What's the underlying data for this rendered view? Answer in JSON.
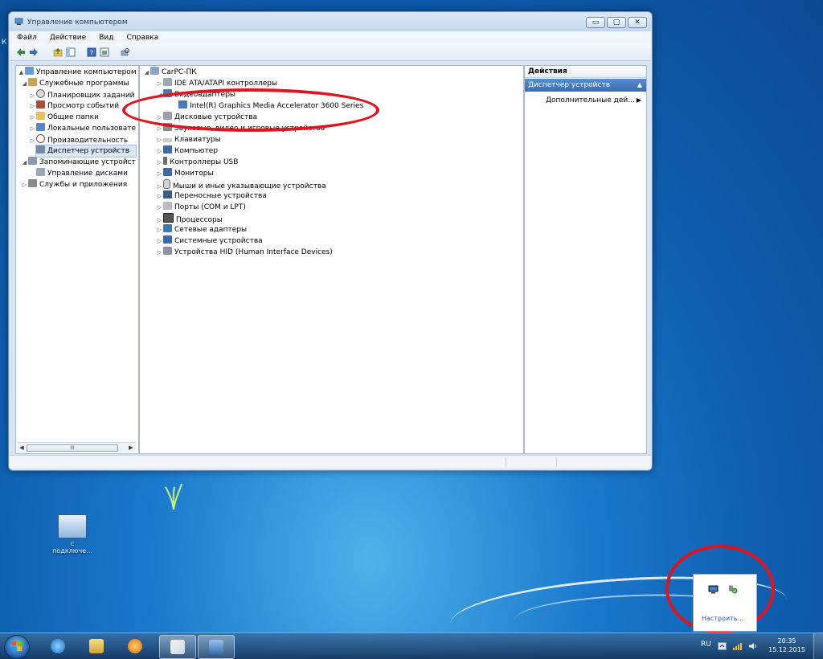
{
  "window": {
    "title": "Управление компьютером",
    "buttons": {
      "minimize": "▭",
      "maximize": "▢",
      "close": "✕"
    }
  },
  "menu": [
    "Файл",
    "Действие",
    "Вид",
    "Справка"
  ],
  "left_tree": [
    {
      "label": "Управление компьютером (л",
      "exp": "▲"
    },
    {
      "label": "Служебные программы",
      "exp": "◢"
    },
    {
      "label": "Планировщик заданий",
      "exp": "▷"
    },
    {
      "label": "Просмотр событий",
      "exp": "▷"
    },
    {
      "label": "Общие папки",
      "exp": "▷"
    },
    {
      "label": "Локальные пользовате",
      "exp": "▷"
    },
    {
      "label": "Производительность",
      "exp": "▷"
    },
    {
      "label": "Диспетчер устройств",
      "exp": ""
    },
    {
      "label": "Запоминающие устройст",
      "exp": "◢"
    },
    {
      "label": "Управление дисками",
      "exp": ""
    },
    {
      "label": "Службы и приложения",
      "exp": "▷"
    }
  ],
  "left_scroll": {
    "thumb": "III"
  },
  "device_tree": [
    {
      "label": "CarPC-ПК",
      "exp": "◢"
    },
    {
      "label": "IDE ATA/ATAPI контроллеры",
      "exp": "▷"
    },
    {
      "label": "Видеоадаптеры",
      "exp": "◢"
    },
    {
      "label": "Intel(R) Graphics Media Accelerator 3600 Series",
      "exp": ""
    },
    {
      "label": "Дисковые устройства",
      "exp": "▷"
    },
    {
      "label": "Звуковые, видео и игровые устройства",
      "exp": "▷"
    },
    {
      "label": "Клавиатуры",
      "exp": "▷"
    },
    {
      "label": "Компьютер",
      "exp": "▷"
    },
    {
      "label": "Контроллеры USB",
      "exp": "▷"
    },
    {
      "label": "Мониторы",
      "exp": "▷"
    },
    {
      "label": "Мыши и иные указывающие устройства",
      "exp": "▷"
    },
    {
      "label": "Переносные устройства",
      "exp": "▷"
    },
    {
      "label": "Порты (COM и LPT)",
      "exp": "▷"
    },
    {
      "label": "Процессоры",
      "exp": "▷"
    },
    {
      "label": "Сетевые адаптеры",
      "exp": "▷"
    },
    {
      "label": "Системные устройства",
      "exp": "▷"
    },
    {
      "label": "Устройства HID (Human Interface Devices)",
      "exp": "▷"
    }
  ],
  "actions": {
    "header": "Действия",
    "section": "Диспетчер устройств",
    "section_arrow": "▲",
    "more": "Дополнительные дей...",
    "more_arrow": "▶"
  },
  "desktop_icon": {
    "label_line1": "с",
    "label_line2": "подключе..."
  },
  "tray_popup": {
    "link": "Настроить..."
  },
  "taskbar": {
    "lang": "RU",
    "time": "20:35",
    "date": "15.12.2015"
  },
  "edge_text": "К",
  "colors": {
    "annotation": "#e0141e",
    "selection": "#d9e6f5",
    "accent": "#3a6db1"
  }
}
